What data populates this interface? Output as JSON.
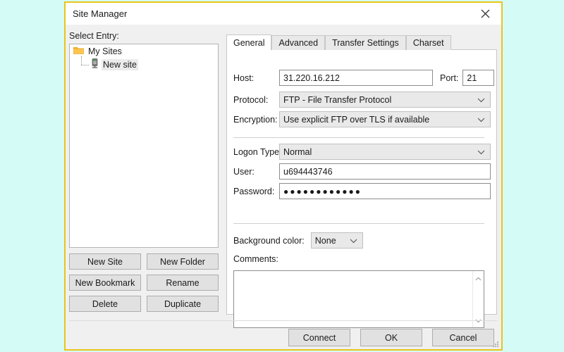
{
  "window": {
    "title": "Site Manager",
    "close_icon": "close-icon",
    "border_color": "#e8c51b",
    "desktop_background": "#d5fbf6"
  },
  "left_panel": {
    "label": "Select Entry:",
    "tree": [
      {
        "label": "My Sites",
        "icon": "folder-icon",
        "selected": false
      },
      {
        "label": "New site",
        "icon": "server-icon",
        "selected": true
      }
    ],
    "buttons": [
      {
        "label": "New Site"
      },
      {
        "label": "New Folder"
      },
      {
        "label": "New Bookmark"
      },
      {
        "label": "Rename"
      },
      {
        "label": "Delete"
      },
      {
        "label": "Duplicate"
      }
    ]
  },
  "tabs": [
    {
      "label": "General",
      "active": true
    },
    {
      "label": "Advanced",
      "active": false
    },
    {
      "label": "Transfer Settings",
      "active": false
    },
    {
      "label": "Charset",
      "active": false
    }
  ],
  "general": {
    "host": {
      "label": "Host:",
      "value": "31.220.16.212"
    },
    "port": {
      "label": "Port:",
      "value": "21"
    },
    "protocol": {
      "label": "Protocol:",
      "value": "FTP - File Transfer Protocol"
    },
    "encryption": {
      "label": "Encryption:",
      "value": "Use explicit FTP over TLS if available"
    },
    "logon_type": {
      "label": "Logon Type:",
      "value": "Normal"
    },
    "user": {
      "label": "User:",
      "value": "u694443746"
    },
    "password": {
      "label": "Password:",
      "value": "············",
      "dots": 12
    },
    "background_color": {
      "label": "Background color:",
      "value": "None"
    },
    "comments": {
      "label": "Comments:",
      "value": ""
    }
  },
  "footer": {
    "connect": "Connect",
    "ok": "OK",
    "cancel": "Cancel"
  }
}
